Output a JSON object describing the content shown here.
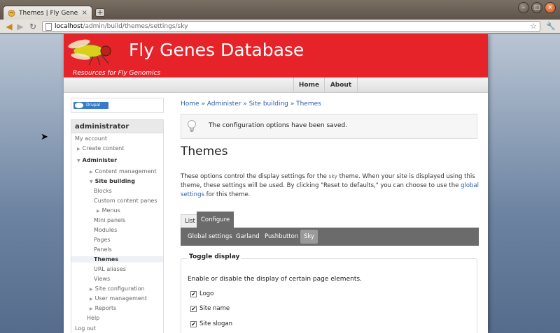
{
  "browser": {
    "tab_title": "Themes | Fly Genes D...",
    "tab_close": "×",
    "new_tab": "+",
    "url_host": "localhost",
    "url_path": "/admin/build/themes/settings/sky",
    "back_icon": "back-arrow-icon",
    "star_icon": "star-icon"
  },
  "site": {
    "name": "Fly Genes Database",
    "slogan": "Resources for Fly Genomics",
    "banner_color": "#e7232a"
  },
  "primary_nav": {
    "items": [
      {
        "label": "Home"
      },
      {
        "label": "About"
      }
    ]
  },
  "drupal_badge": "Drupal",
  "sidebar": {
    "title": "administrator",
    "items": [
      {
        "label": "My account"
      },
      {
        "label": "Create content"
      },
      {
        "label": "Administer"
      },
      {
        "label": "Content management"
      },
      {
        "label": "Site building"
      },
      {
        "label": "Blocks"
      },
      {
        "label": "Custom content panes"
      },
      {
        "label": "Menus"
      },
      {
        "label": "Mini panels"
      },
      {
        "label": "Modules"
      },
      {
        "label": "Pages"
      },
      {
        "label": "Panels"
      },
      {
        "label": "Themes"
      },
      {
        "label": "URL aliases"
      },
      {
        "label": "Views"
      },
      {
        "label": "Site configuration"
      },
      {
        "label": "User management"
      },
      {
        "label": "Reports"
      },
      {
        "label": "Help"
      },
      {
        "label": "Log out"
      }
    ]
  },
  "content": {
    "breadcrumb": "Home » Administer » Site building » Themes",
    "message": "The configuration options have been saved.",
    "title": "Themes",
    "desc_1": "These options control the display settings for the ",
    "desc_code": "sky",
    "desc_2": " theme. When your site is displayed using this theme, these settings will be used. By clicking \"Reset to defaults,\" you can choose to use the ",
    "desc_link": "global settings",
    "desc_3": " for this theme.",
    "tabs": [
      {
        "label": "List"
      },
      {
        "label": "Configure"
      }
    ],
    "subtabs": [
      {
        "label": "Global settings"
      },
      {
        "label": "Garland"
      },
      {
        "label": "Pushbutton"
      },
      {
        "label": "Sky"
      }
    ],
    "fieldset_legend": "Toggle display",
    "fieldset_desc": "Enable or disable the display of certain page elements.",
    "checkboxes": [
      {
        "label": "Logo",
        "checked": "✔"
      },
      {
        "label": "Site name",
        "checked": "✔"
      },
      {
        "label": "Site slogan",
        "checked": "✔"
      }
    ]
  }
}
